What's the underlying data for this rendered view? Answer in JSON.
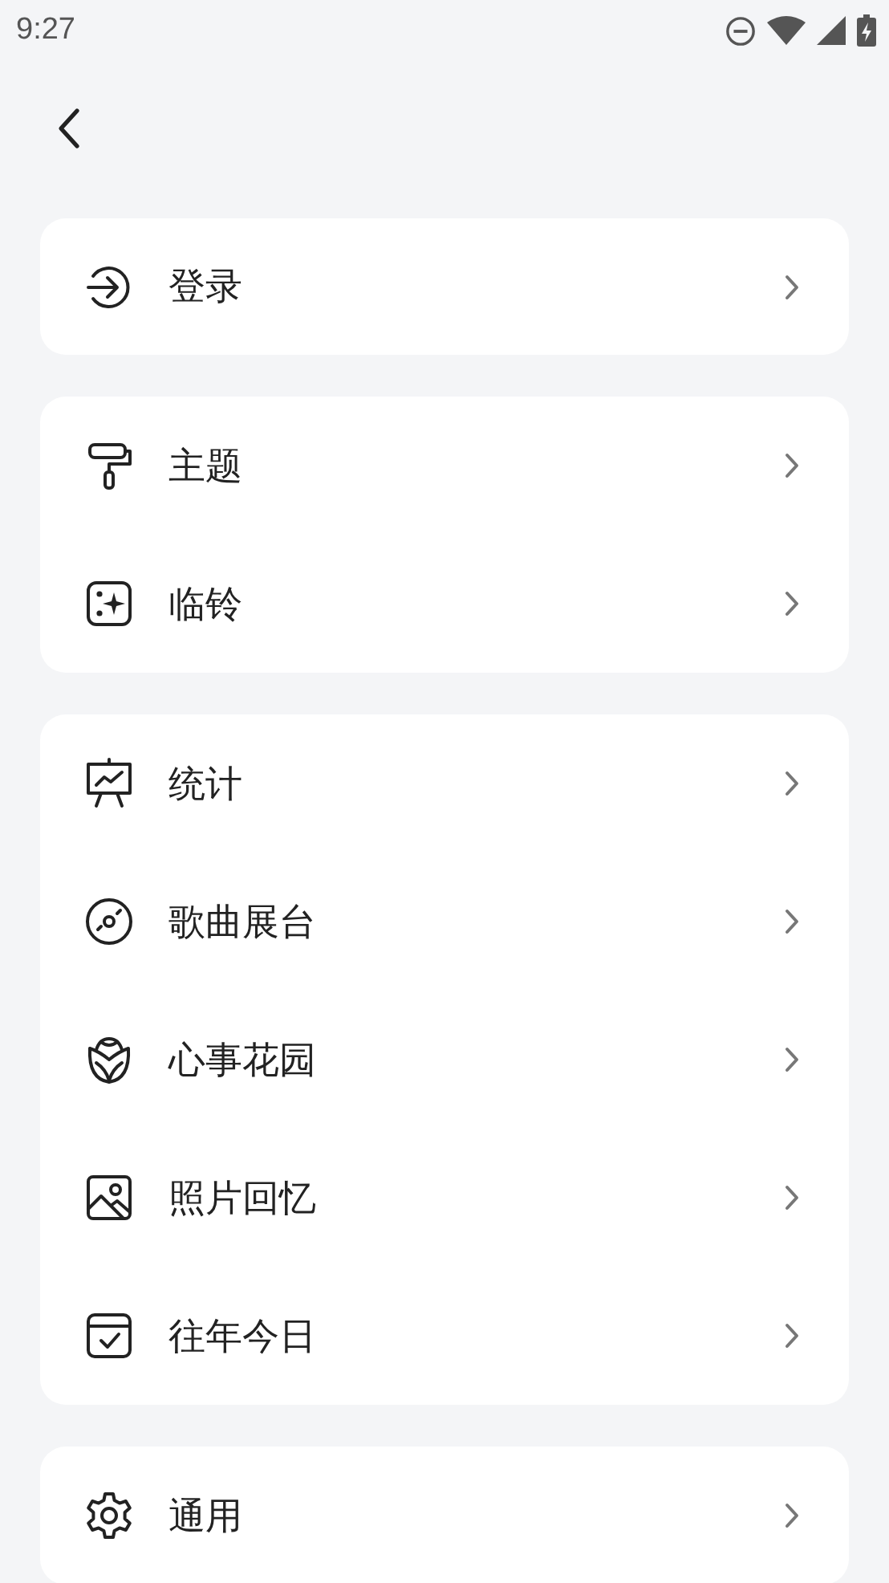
{
  "status_bar": {
    "time": "9:27"
  },
  "groups": [
    {
      "items": [
        {
          "kind": "login",
          "label": "登录"
        }
      ]
    },
    {
      "items": [
        {
          "kind": "roller",
          "label": "主题"
        },
        {
          "kind": "sparkle",
          "label": "临铃"
        }
      ]
    },
    {
      "items": [
        {
          "kind": "board",
          "label": "统计"
        },
        {
          "kind": "disc",
          "label": "歌曲展台"
        },
        {
          "kind": "rose",
          "label": "心事花园"
        },
        {
          "kind": "image",
          "label": "照片回忆"
        },
        {
          "kind": "calendar",
          "label": "往年今日"
        }
      ]
    },
    {
      "items": [
        {
          "kind": "gear",
          "label": "通用"
        }
      ]
    }
  ]
}
